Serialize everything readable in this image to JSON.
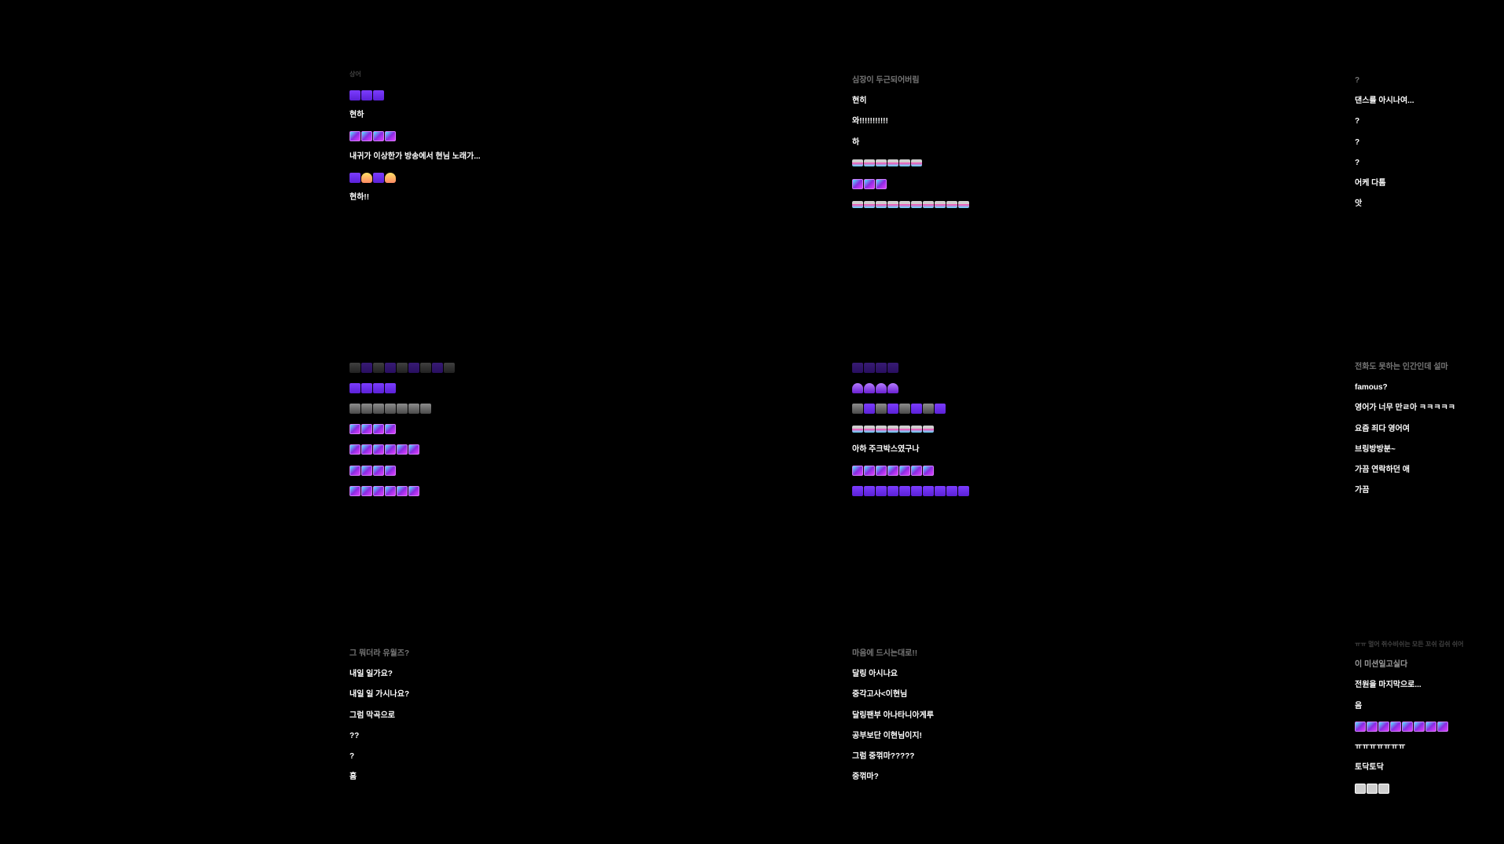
{
  "colors": {
    "background": "#000000",
    "text": "#ffffff",
    "emote_purple": "#7b3cff",
    "emote_cyan": "#4df0ff",
    "emote_pink": "#ff4fb3"
  },
  "panels": [
    {
      "lines": [
        {
          "type": "text",
          "text": "상어",
          "style": "very-faded"
        },
        {
          "type": "emote",
          "emotes": [
            "purple-person-icon",
            "purple-person-icon",
            "purple-person-icon"
          ]
        },
        {
          "type": "text",
          "text": "현하"
        },
        {
          "type": "emote",
          "emotes": [
            "neon-banner-icon",
            "neon-banner-icon",
            "neon-banner-icon",
            "neon-banner-icon"
          ]
        },
        {
          "type": "text",
          "text": "내귀가 이상한가 방송에서 현님 노래가..."
        },
        {
          "type": "emote",
          "emotes": [
            "purple-person-icon",
            "yellow-face-icon",
            "purple-person-icon",
            "yellow-face-icon"
          ]
        },
        {
          "type": "text",
          "text": "현하!!"
        }
      ]
    },
    {
      "lines": [
        {
          "type": "text",
          "text": "심장이 두근되어버림",
          "style": "faded"
        },
        {
          "type": "text",
          "text": "현히"
        },
        {
          "type": "text",
          "text": "와!!!!!!!!!!!"
        },
        {
          "type": "text",
          "text": "하"
        },
        {
          "type": "emote",
          "emotes": [
            "rainbow-wave-icon",
            "rainbow-wave-icon",
            "rainbow-wave-icon",
            "rainbow-wave-icon",
            "rainbow-wave-icon",
            "rainbow-wave-icon"
          ]
        },
        {
          "type": "emote",
          "emotes": [
            "neon-banner-icon",
            "neon-banner-icon",
            "neon-banner-icon"
          ]
        },
        {
          "type": "emote",
          "emotes": [
            "rainbow-wave-icon",
            "rainbow-wave-icon",
            "rainbow-wave-icon",
            "rainbow-wave-icon",
            "rainbow-wave-icon",
            "rainbow-wave-icon",
            "rainbow-wave-icon",
            "rainbow-wave-icon",
            "rainbow-wave-icon",
            "rainbow-wave-icon"
          ]
        }
      ]
    },
    {
      "lines": [
        {
          "type": "text",
          "text": "?",
          "style": "faded"
        },
        {
          "type": "text",
          "text": "댄스를 아시나여..."
        },
        {
          "type": "text",
          "text": "?"
        },
        {
          "type": "text",
          "text": "?"
        },
        {
          "type": "text",
          "text": "?"
        },
        {
          "type": "text",
          "text": "어케 다톰"
        },
        {
          "type": "text",
          "text": "앗"
        }
      ]
    },
    {
      "lines": [
        {
          "type": "emote",
          "emotes": [
            "gray-cat-icon",
            "purple-cat-icon",
            "gray-cat-icon",
            "purple-cat-icon",
            "gray-cat-icon",
            "purple-cat-icon",
            "gray-cat-icon",
            "purple-cat-icon",
            "gray-cat-icon"
          ],
          "style": "faded"
        },
        {
          "type": "emote",
          "emotes": [
            "purple-cat-icon",
            "purple-cat-icon",
            "purple-cat-icon",
            "purple-cat-icon"
          ]
        },
        {
          "type": "emote",
          "emotes": [
            "gray-cat-icon",
            "gray-cat-icon",
            "gray-cat-icon",
            "gray-cat-icon",
            "gray-cat-icon",
            "gray-cat-icon",
            "gray-cat-icon"
          ]
        },
        {
          "type": "emote",
          "emotes": [
            "neon-banner-icon",
            "neon-banner-icon",
            "neon-banner-icon",
            "neon-banner-icon"
          ]
        },
        {
          "type": "emote",
          "emotes": [
            "neon-banner-icon",
            "neon-banner-icon",
            "neon-banner-icon",
            "neon-banner-icon",
            "neon-banner-icon",
            "neon-banner-icon"
          ]
        },
        {
          "type": "emote",
          "emotes": [
            "neon-banner-icon",
            "neon-banner-icon",
            "neon-banner-icon",
            "neon-banner-icon"
          ]
        },
        {
          "type": "emote",
          "emotes": [
            "neon-banner-icon",
            "neon-banner-icon",
            "neon-banner-icon",
            "neon-banner-icon",
            "neon-banner-icon",
            "neon-banner-icon"
          ]
        }
      ]
    },
    {
      "lines": [
        {
          "type": "emote",
          "emotes": [
            "purple-cat-icon",
            "purple-cat-icon",
            "purple-cat-icon",
            "purple-cat-icon"
          ],
          "style": "faded"
        },
        {
          "type": "emote",
          "emotes": [
            "purple-ghost-icon",
            "purple-ghost-icon",
            "purple-ghost-icon",
            "purple-ghost-icon"
          ]
        },
        {
          "type": "emote",
          "emotes": [
            "gray-cat-icon",
            "purple-cat-icon",
            "gray-cat-icon",
            "purple-cat-icon",
            "gray-cat-icon",
            "purple-cat-icon",
            "gray-cat-icon",
            "purple-cat-icon"
          ]
        },
        {
          "type": "emote",
          "emotes": [
            "pink-block-icon",
            "pink-block-icon",
            "pink-block-icon",
            "pink-block-icon",
            "pink-block-icon",
            "pink-block-icon",
            "pink-block-icon"
          ]
        },
        {
          "type": "text",
          "text": "아하 주크박스였구나"
        },
        {
          "type": "emote",
          "emotes": [
            "neon-banner-icon",
            "neon-banner-icon",
            "neon-banner-icon",
            "neon-banner-icon",
            "neon-banner-icon",
            "neon-banner-icon",
            "neon-banner-icon"
          ]
        },
        {
          "type": "emote",
          "emotes": [
            "purple-cat-icon",
            "purple-cat-icon",
            "purple-cat-icon",
            "purple-cat-icon",
            "purple-cat-icon",
            "purple-cat-icon",
            "purple-cat-icon",
            "purple-cat-icon",
            "purple-cat-icon",
            "purple-cat-icon"
          ]
        }
      ]
    },
    {
      "lines": [
        {
          "type": "text",
          "text": "전화도 못하는 인간인데 설마",
          "style": "faded"
        },
        {
          "type": "text",
          "text": "famous?"
        },
        {
          "type": "text",
          "text": "영어가 너무 만ㄹ아 ㅋㅋㅋㅋㅋ"
        },
        {
          "type": "text",
          "text": "요즘 죄다 영어여"
        },
        {
          "type": "text",
          "text": "브링방방분~"
        },
        {
          "type": "text",
          "text": "가끔 연락하던 애"
        },
        {
          "type": "text",
          "text": "가끔"
        }
      ]
    },
    {
      "lines": [
        {
          "type": "text",
          "text": "그 뭐더라 유월즈?",
          "style": "faded"
        },
        {
          "type": "text",
          "text": "내일 일가요?"
        },
        {
          "type": "text",
          "text": "내일 일 가시나요?"
        },
        {
          "type": "text",
          "text": "그럼 막곡으로"
        },
        {
          "type": "text",
          "text": "??"
        },
        {
          "type": "text",
          "text": "?"
        },
        {
          "type": "text",
          "text": "흠"
        }
      ]
    },
    {
      "lines": [
        {
          "type": "text",
          "text": "마음에 드시는대로!!",
          "style": "faded"
        },
        {
          "type": "text",
          "text": "달링 아시나요"
        },
        {
          "type": "text",
          "text": "중각고사<이현님"
        },
        {
          "type": "text",
          "text": "달링팬부 아나타니아게루"
        },
        {
          "type": "text",
          "text": "공부보단 이현님이지!"
        },
        {
          "type": "text",
          "text": "그럼 중꺾마?????"
        },
        {
          "type": "text",
          "text": "중꺾마?"
        }
      ]
    },
    {
      "lines": [
        {
          "type": "text",
          "text": "ㅠㅠ 멀어 쥐수비쉬는 모든 꼬쉬 김쉬 쉬어",
          "style": "very-faded"
        },
        {
          "type": "text",
          "text": "이 미션일고실다",
          "style": "fading"
        },
        {
          "type": "text",
          "text": "전원을 마지막으로..."
        },
        {
          "type": "text",
          "text": "음"
        },
        {
          "type": "emote",
          "emotes": [
            "neon-banner-icon",
            "neon-banner-icon",
            "neon-banner-icon",
            "neon-banner-icon",
            "neon-banner-icon",
            "neon-banner-icon",
            "neon-banner-icon",
            "neon-banner-icon"
          ]
        },
        {
          "type": "text",
          "text": "ㅠㅠㅠㅠㅠㅠㅠ"
        },
        {
          "type": "text",
          "text": "토닥토닥"
        },
        {
          "type": "emote",
          "emotes": [
            "gray-face-icon",
            "gray-face-icon",
            "gray-face-icon"
          ]
        }
      ]
    }
  ]
}
